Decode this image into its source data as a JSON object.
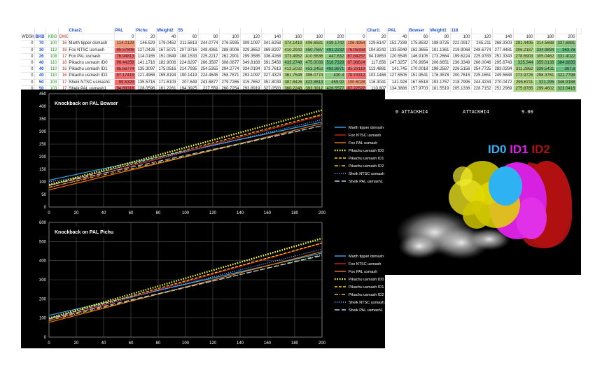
{
  "sheet": {
    "header": {
      "wdsk": "WDSK",
      "bkb": "BKB",
      "kbg": "KBG",
      "dmg": "DMG",
      "char1_label": "Char2:",
      "char1_region": "PAL",
      "char1_name": "Pichu",
      "weight1_label": "Weight2",
      "weight1_value": "55",
      "char2_label": "Char1:",
      "char2_region": "PAL",
      "char2_name": "Bowser",
      "weight2_label": "Weight1",
      "weight2_value": "118"
    },
    "percent_headers": [
      "0",
      "20",
      "40",
      "60",
      "80",
      "100",
      "120",
      "140",
      "160",
      "180",
      "200",
      "0",
      "20",
      "40",
      "60",
      "80",
      "100",
      "120",
      "140",
      "160",
      "180",
      "200"
    ],
    "rows": [
      {
        "wdsk": "0",
        "bkb": "70",
        "kbg": "100",
        "dmg": "16",
        "move": "Marth tipper dsmash",
        "v": [
          "114.0129",
          "146.529",
          "179.0452",
          "211.5613",
          "244.0774",
          "276.5935",
          "309.1097",
          "341.6258",
          "374.1419",
          "406.6581",
          "439.1742",
          "106.4954",
          "129.6147",
          "152.7339",
          "175.8532",
          "198.9725",
          "222.0917",
          "245.211",
          "268.3303",
          "291.4495",
          "314.5688",
          "337.6881"
        ]
      },
      {
        "wdsk": "0",
        "bkb": "30",
        "kbg": "112",
        "dmg": "16",
        "move": "Fox NTSC usmash",
        "v": [
          "85.57806",
          "127.0426",
          "167.5071",
          "207.9716",
          "248.4361",
          "288.9006",
          "329.3652",
          "369.8297",
          "410.2942",
          "450.7587",
          "491.2232",
          "76.05358",
          "104.8242",
          "133.5949",
          "162.3655",
          "191.1361",
          "219.9068",
          "248.6774",
          "277.4481",
          "306.2187",
          "334.9894",
          "363.76"
        ]
      },
      {
        "wdsk": "0",
        "bkb": "26",
        "kbg": "108",
        "dmg": "17",
        "move": "Fox PAL usmash",
        "v": [
          "76.94813",
          "114.0165",
          "151.0849",
          "188.1533",
          "225.2217",
          "262.2901",
          "299.3585",
          "336.4268",
          "373.4952",
          "410.5636",
          "447.632",
          "67.84257",
          "94.19853",
          "120.5545",
          "146.9105",
          "173.2664",
          "199.6224",
          "225.9783",
          "252.3343",
          "278.6903",
          "305.0462",
          "331.4022"
        ]
      },
      {
        "wdsk": "0",
        "bkb": "40",
        "kbg": "110",
        "dmg": "16",
        "move": "Pikachu usmash ID0",
        "v": [
          "99.44258",
          "141.1716",
          "182.9006",
          "224.6297",
          "266.3587",
          "308.0877",
          "349.8168",
          "391.5458",
          "433.2748",
          "475.0039",
          "516.7329",
          "87.98624",
          "117.656",
          "147.3257",
          "176.9954",
          "206.6651",
          "236.3349",
          "266.0046",
          "295.6743",
          "325.344",
          "355.0138",
          "384.6835"
        ]
      },
      {
        "wdsk": "0",
        "bkb": "40",
        "kbg": "110",
        "dmg": "16",
        "move": "Pikachu usmash ID1",
        "v": [
          "95.56774",
          "135.3097",
          "175.0516",
          "214.7935",
          "254.5355",
          "294.2774",
          "334.0194",
          "373.7613",
          "413.5032",
          "453.2452",
          "492.9871",
          "85.23119",
          "113.4881",
          "141.745",
          "170.0018",
          "198.2587",
          "226.5156",
          "254.7725",
          "283.0294",
          "311.2862",
          "339.5431",
          "367.8"
        ]
      },
      {
        "wdsk": "0",
        "bkb": "40",
        "kbg": "110",
        "dmg": "16",
        "move": "Pikachu usmash ID2",
        "v": [
          "87.17419",
          "121.4968",
          "155.8194",
          "190.1419",
          "224.4645",
          "258.7871",
          "293.1097",
          "327.4323",
          "361.7548",
          "396.0774",
          "430.4",
          "78.74312",
          "103.1468",
          "127.5505",
          "151.9541",
          "176.3578",
          "200.7615",
          "225.1651",
          "249.5688",
          "273.9725",
          "298.3761",
          "322.7798"
        ]
      },
      {
        "wdsk": "0",
        "bkb": "50",
        "kbg": "103",
        "dmg": "17",
        "move": "Sheik NTSC usmash1",
        "v": [
          "99.5329",
          "135.5716",
          "171.6103",
          "207.649",
          "243.6877",
          "279.7265",
          "315.7652",
          "351.8039",
          "387.8426",
          "423.8813",
          "459.92",
          "100.6028",
          "116.3041",
          "141.928",
          "167.5518",
          "193.1757",
          "218.7995",
          "244.4234",
          "270.0472",
          "295.6711",
          "321.295",
          "346.9188"
        ]
      },
      {
        "wdsk": "0",
        "bkb": "50",
        "kbg": "103",
        "dmg": "17",
        "move": "Sheik PAL usmash1",
        "v": [
          "94.89316",
          "128.0596",
          "161.2261",
          "194.3925",
          "227.559",
          "260.7254",
          "293.8919",
          "327.0583",
          "360.2248",
          "393.3912",
          "426.5577",
          "87.22522",
          "110.807",
          "134.3886",
          "157.9703",
          "181.5519",
          "205.1336",
          "228.7152",
          "252.2969",
          "275.8785",
          "299.4602",
          "323.0418"
        ]
      }
    ]
  },
  "chart_data": [
    {
      "type": "line",
      "title": "Knockback on   PAL   Bowser",
      "x": [
        0,
        20,
        40,
        60,
        80,
        100,
        120,
        140,
        160,
        180,
        200
      ],
      "xlim": [
        0,
        200
      ],
      "xticks": [
        "0",
        "20",
        "40",
        "60",
        "80",
        "100",
        "120",
        "140",
        "160",
        "180",
        "200"
      ],
      "ylim": [
        0,
        450
      ],
      "yticks": [
        "0",
        "50",
        "100",
        "150",
        "200",
        "250",
        "300",
        "350",
        "400",
        "450"
      ],
      "grid": true,
      "legend": "right",
      "series": [
        {
          "name": "Marth tipper dsmash",
          "color": "#35a9ee",
          "style": "solid",
          "values": [
            106.5,
            129.6,
            152.7,
            175.9,
            199.0,
            222.1,
            245.2,
            268.3,
            291.4,
            314.6,
            337.7
          ]
        },
        {
          "name": "Fox NTSC usmash",
          "color": "#d02020",
          "style": "solid",
          "values": [
            76.1,
            104.8,
            133.6,
            162.4,
            191.1,
            219.9,
            248.7,
            277.4,
            306.2,
            335.0,
            363.8
          ]
        },
        {
          "name": "Fox PAL usmash",
          "color": "#f07818",
          "style": "solid",
          "values": [
            67.8,
            94.2,
            120.6,
            146.9,
            173.3,
            199.6,
            226.0,
            252.3,
            278.7,
            305.0,
            331.4
          ]
        },
        {
          "name": "Pikachu usmash ID0",
          "color": "#ffff30",
          "style": "dotted-thick",
          "values": [
            88.0,
            117.7,
            147.3,
            177.0,
            206.7,
            236.3,
            266.0,
            295.7,
            325.3,
            355.0,
            384.7
          ]
        },
        {
          "name": "Pikachu usmash ID1",
          "color": "#f4d414",
          "style": "dashed",
          "values": [
            85.2,
            113.5,
            141.7,
            170.0,
            198.3,
            226.5,
            254.8,
            283.0,
            311.3,
            339.5,
            367.8
          ]
        },
        {
          "name": "Pikachu usmash ID2",
          "color": "#d8c020",
          "style": "dashdot",
          "values": [
            78.7,
            103.1,
            127.6,
            152.0,
            176.4,
            200.8,
            225.2,
            249.6,
            274.0,
            298.4,
            322.8
          ]
        },
        {
          "name": "Sheik NTSC usmash1",
          "color": "#8aa8ff",
          "style": "dotted",
          "values": [
            100.6,
            116.3,
            141.9,
            167.6,
            193.2,
            218.8,
            244.4,
            270.0,
            295.7,
            321.3,
            346.9
          ]
        },
        {
          "name": "Sheik PAL usmash1",
          "color": "#a8c8e8",
          "style": "longdash",
          "values": [
            87.2,
            110.8,
            134.4,
            158.0,
            181.6,
            205.1,
            228.7,
            252.3,
            275.9,
            299.5,
            323.0
          ]
        }
      ]
    },
    {
      "type": "line",
      "title": "Knockback on   PAL   Pichu",
      "x": [
        0,
        20,
        40,
        60,
        80,
        100,
        120,
        140,
        160,
        180,
        200
      ],
      "xlim": [
        0,
        200
      ],
      "xticks": [
        "0",
        "20",
        "40",
        "60",
        "80",
        "100",
        "120",
        "140",
        "160",
        "180",
        "200"
      ],
      "ylim": [
        0,
        600
      ],
      "yticks": [
        "0",
        "100",
        "200",
        "300",
        "400",
        "500",
        "600"
      ],
      "grid": true,
      "legend": "right",
      "series": [
        {
          "name": "Marth tipper dsmash",
          "color": "#35a9ee",
          "style": "solid",
          "values": [
            114.0,
            146.5,
            179.0,
            211.6,
            244.1,
            276.6,
            309.1,
            341.6,
            374.1,
            406.7,
            439.2
          ]
        },
        {
          "name": "Fox NTSC usmash",
          "color": "#d02020",
          "style": "solid",
          "values": [
            85.6,
            127.0,
            167.5,
            208.0,
            248.4,
            288.9,
            329.4,
            369.8,
            410.3,
            450.8,
            491.2
          ]
        },
        {
          "name": "Fox PAL usmash",
          "color": "#f07818",
          "style": "solid",
          "values": [
            76.9,
            114.0,
            151.1,
            188.2,
            225.2,
            262.3,
            299.4,
            336.4,
            373.5,
            410.6,
            447.6
          ]
        },
        {
          "name": "Pikachu usmash ID0",
          "color": "#ffff30",
          "style": "dotted-thick",
          "values": [
            99.4,
            141.2,
            182.9,
            224.6,
            266.4,
            308.1,
            349.8,
            391.5,
            433.3,
            475.0,
            516.7
          ]
        },
        {
          "name": "Pikachu usmash ID1",
          "color": "#f4d414",
          "style": "dashed",
          "values": [
            95.6,
            135.3,
            175.1,
            214.8,
            254.5,
            294.3,
            334.0,
            373.8,
            413.5,
            453.2,
            493.0
          ]
        },
        {
          "name": "Pikachu usmash ID2",
          "color": "#d8c020",
          "style": "dashdot",
          "values": [
            87.2,
            121.5,
            155.8,
            190.1,
            224.5,
            258.8,
            293.1,
            327.4,
            361.8,
            396.1,
            430.4
          ]
        },
        {
          "name": "Sheik NTSC usmash1",
          "color": "#8aa8ff",
          "style": "dotted",
          "values": [
            99.5,
            135.6,
            171.6,
            207.6,
            243.7,
            279.7,
            315.8,
            351.8,
            387.8,
            423.9,
            459.9
          ]
        },
        {
          "name": "Sheik PAL usmash1",
          "color": "#a8c8e8",
          "style": "longdash",
          "values": [
            94.9,
            128.1,
            161.2,
            194.4,
            227.6,
            260.7,
            293.9,
            327.1,
            360.2,
            393.4,
            426.6
          ]
        }
      ]
    }
  ],
  "game": {
    "hud_left": "0 ATTACKHI4",
    "hud_mid": "ATTACKHI4",
    "hud_right": "9.00",
    "id0": "ID0",
    "id1": "ID1",
    "id2": "ID2",
    "colors": {
      "id0": "#2fb2f2",
      "id1": "#e020e8",
      "id2": "#b01010",
      "yellow": "#e8e000"
    }
  }
}
